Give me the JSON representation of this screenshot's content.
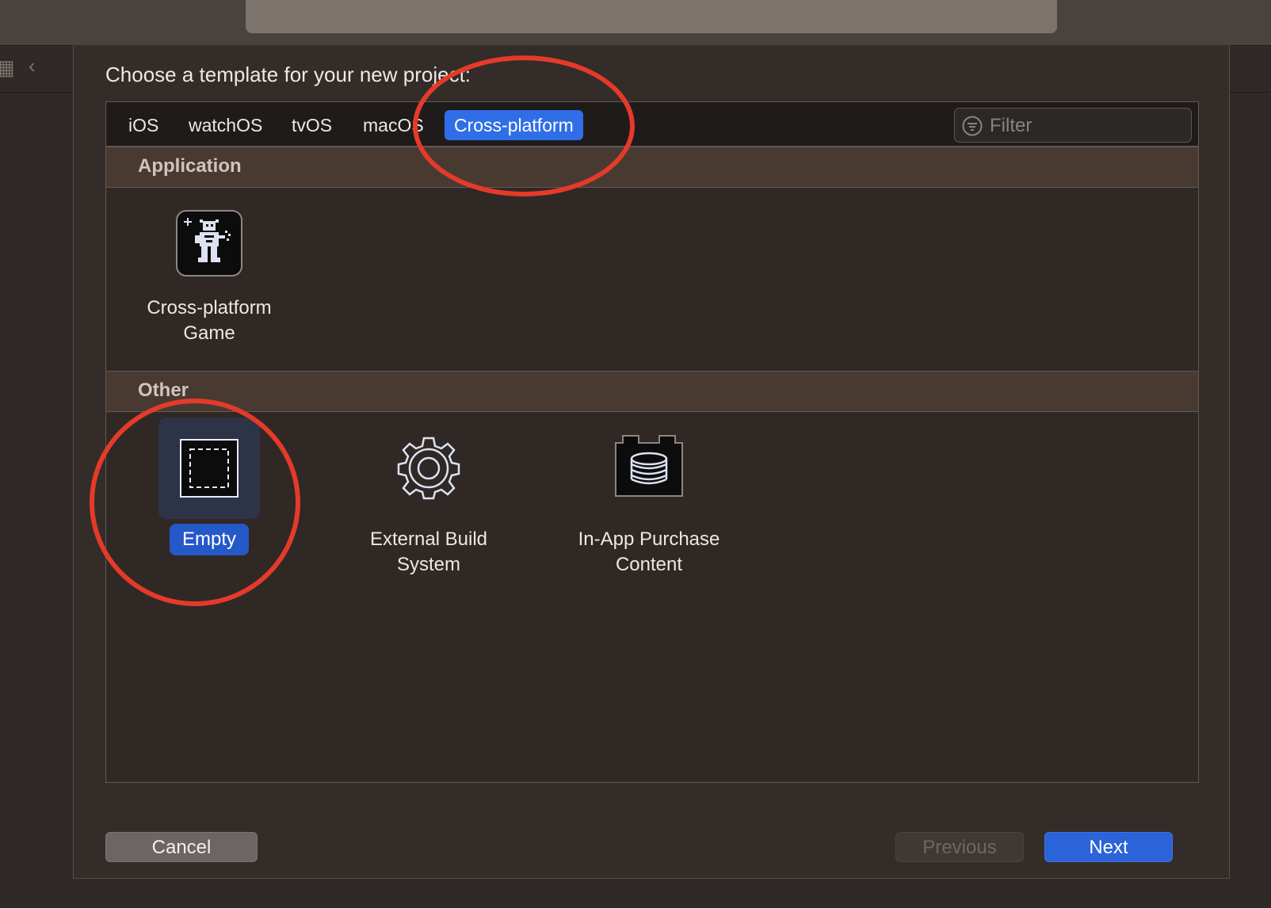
{
  "dialog": {
    "prompt": "Choose a template for your new project:"
  },
  "tabs": [
    {
      "label": "iOS"
    },
    {
      "label": "watchOS"
    },
    {
      "label": "tvOS"
    },
    {
      "label": "macOS"
    },
    {
      "label": "Cross-platform",
      "selected": true
    }
  ],
  "filter": {
    "placeholder": "Filter",
    "icon": "filter-icon"
  },
  "sections": [
    {
      "title": "Application",
      "items": [
        {
          "label": "Cross-platform\nGame",
          "icon": "game-sprite-icon"
        }
      ]
    },
    {
      "title": "Other",
      "items": [
        {
          "label": "Empty",
          "icon": "empty-dashed-square-icon",
          "selected": true
        },
        {
          "label": "External Build\nSystem",
          "icon": "gear-icon"
        },
        {
          "label": "In-App Purchase\nContent",
          "icon": "coin-stack-icon"
        }
      ]
    }
  ],
  "buttons": {
    "cancel": "Cancel",
    "previous": "Previous",
    "next": "Next"
  },
  "colors": {
    "accent": "#2f6ee6",
    "annotation": "#e53a2a"
  }
}
